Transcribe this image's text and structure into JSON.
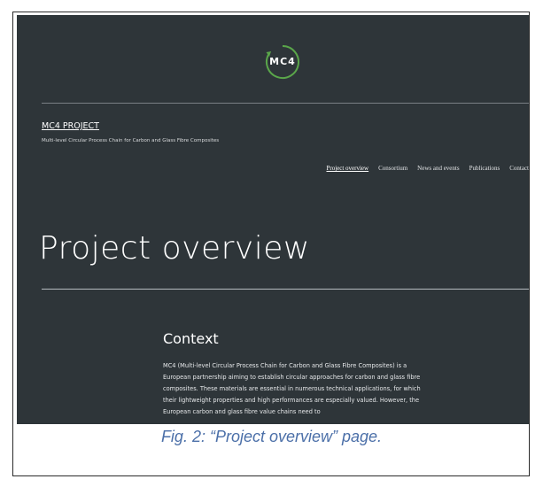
{
  "site": {
    "logo_text": "MC4",
    "title": "MC4 PROJECT",
    "subtitle": "Multi-level Circular Process Chain for Carbon and Glass Fibre Composites"
  },
  "nav": {
    "items": [
      {
        "label": "Project overview",
        "active": true
      },
      {
        "label": "Consortium",
        "active": false
      },
      {
        "label": "News and events",
        "active": false
      },
      {
        "label": "Publications",
        "active": false
      },
      {
        "label": "Contact",
        "active": false
      }
    ]
  },
  "page": {
    "title": "Project overview",
    "section_heading": "Context",
    "section_body": "MC4 (Multi-level Circular Process Chain for Carbon and Glass Fibre Composites) is a European partnership aiming to establish circular approaches for carbon and glass fibre composites. These materials are essential in numerous technical applications, for which their lightweight properties and high performances are especially valued. However, the European carbon and glass fibre value chains need to"
  },
  "caption": "Fig. 2: “Project overview” page.",
  "colors": {
    "background": "#2e3539",
    "logo_ring": "#5aa64a",
    "caption": "#4b6fa8"
  }
}
